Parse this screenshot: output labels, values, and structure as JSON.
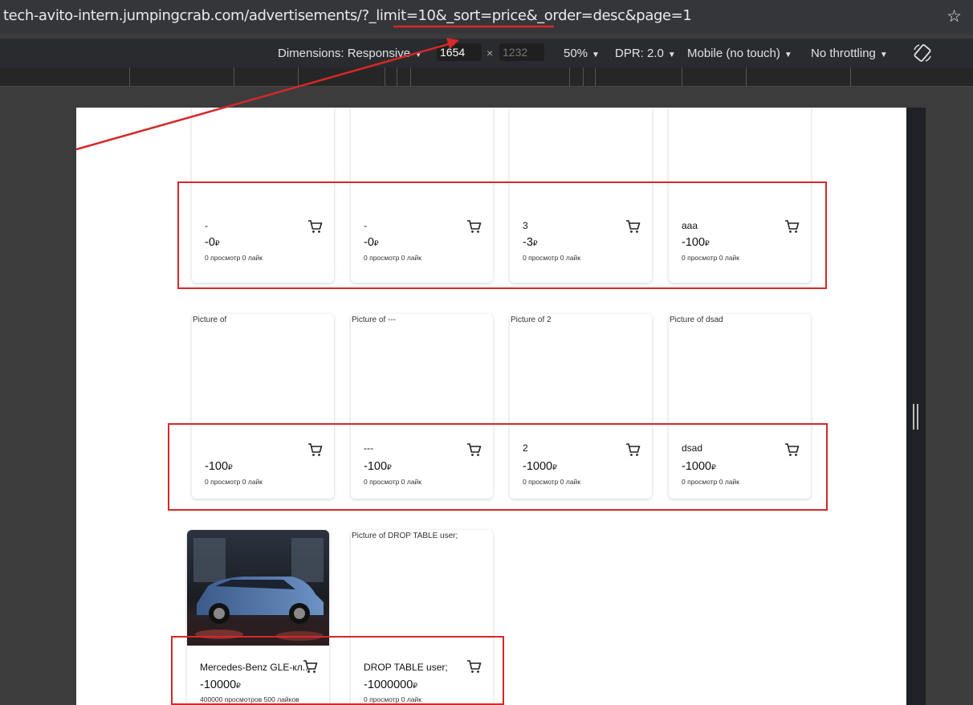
{
  "browser": {
    "url": "tech-avito-intern.jumpingcrab.com/advertisements/?_limit=10&_sort=price&_order=desc&page=1",
    "star_icon": "star-icon"
  },
  "devtools": {
    "dimensions_label": "Dimensions: Responsive",
    "width": "1654",
    "height": "1232",
    "zoom": "50%",
    "dpr": "DPR: 2.0",
    "device": "Mobile (no touch)",
    "throttling": "No throttling"
  },
  "cards": [
    {
      "title": "-",
      "price": "-0",
      "views": "0 просмотр",
      "likes": "0 лайк"
    },
    {
      "title": "-",
      "price": "-0",
      "views": "0 просмотр",
      "likes": "0 лайк"
    },
    {
      "title": "3",
      "price": "-3",
      "views": "0 просмотр",
      "likes": "0 лайк"
    },
    {
      "title": "aaa",
      "price": "-100",
      "views": "0 просмотр",
      "likes": "0 лайк"
    },
    {
      "img_alt": "Picture of",
      "title": "",
      "price": "-100",
      "views": "0 просмотр",
      "likes": "0 лайк"
    },
    {
      "img_alt": "Picture of ---",
      "title": "---",
      "price": "-100",
      "views": "0 просмотр",
      "likes": "0 лайк"
    },
    {
      "img_alt": "Picture of 2",
      "title": "2",
      "price": "-1000",
      "views": "0 просмотр",
      "likes": "0 лайк"
    },
    {
      "img_alt": "Picture of dsad",
      "title": "dsad",
      "price": "-1000",
      "views": "0 просмотр",
      "likes": "0 лайк"
    },
    {
      "title": "Mercedes-Benz GLE-кл...",
      "price": "-10000",
      "views": "400000 просмотров",
      "likes": "500 лайков"
    },
    {
      "img_alt": "Picture of DROP TABLE user;",
      "title": "DROP TABLE user;",
      "price": "-1000000",
      "views": "0 просмотр",
      "likes": "0 лайк"
    }
  ],
  "currency": "₽",
  "colors": {
    "annotation": "#d62828"
  }
}
